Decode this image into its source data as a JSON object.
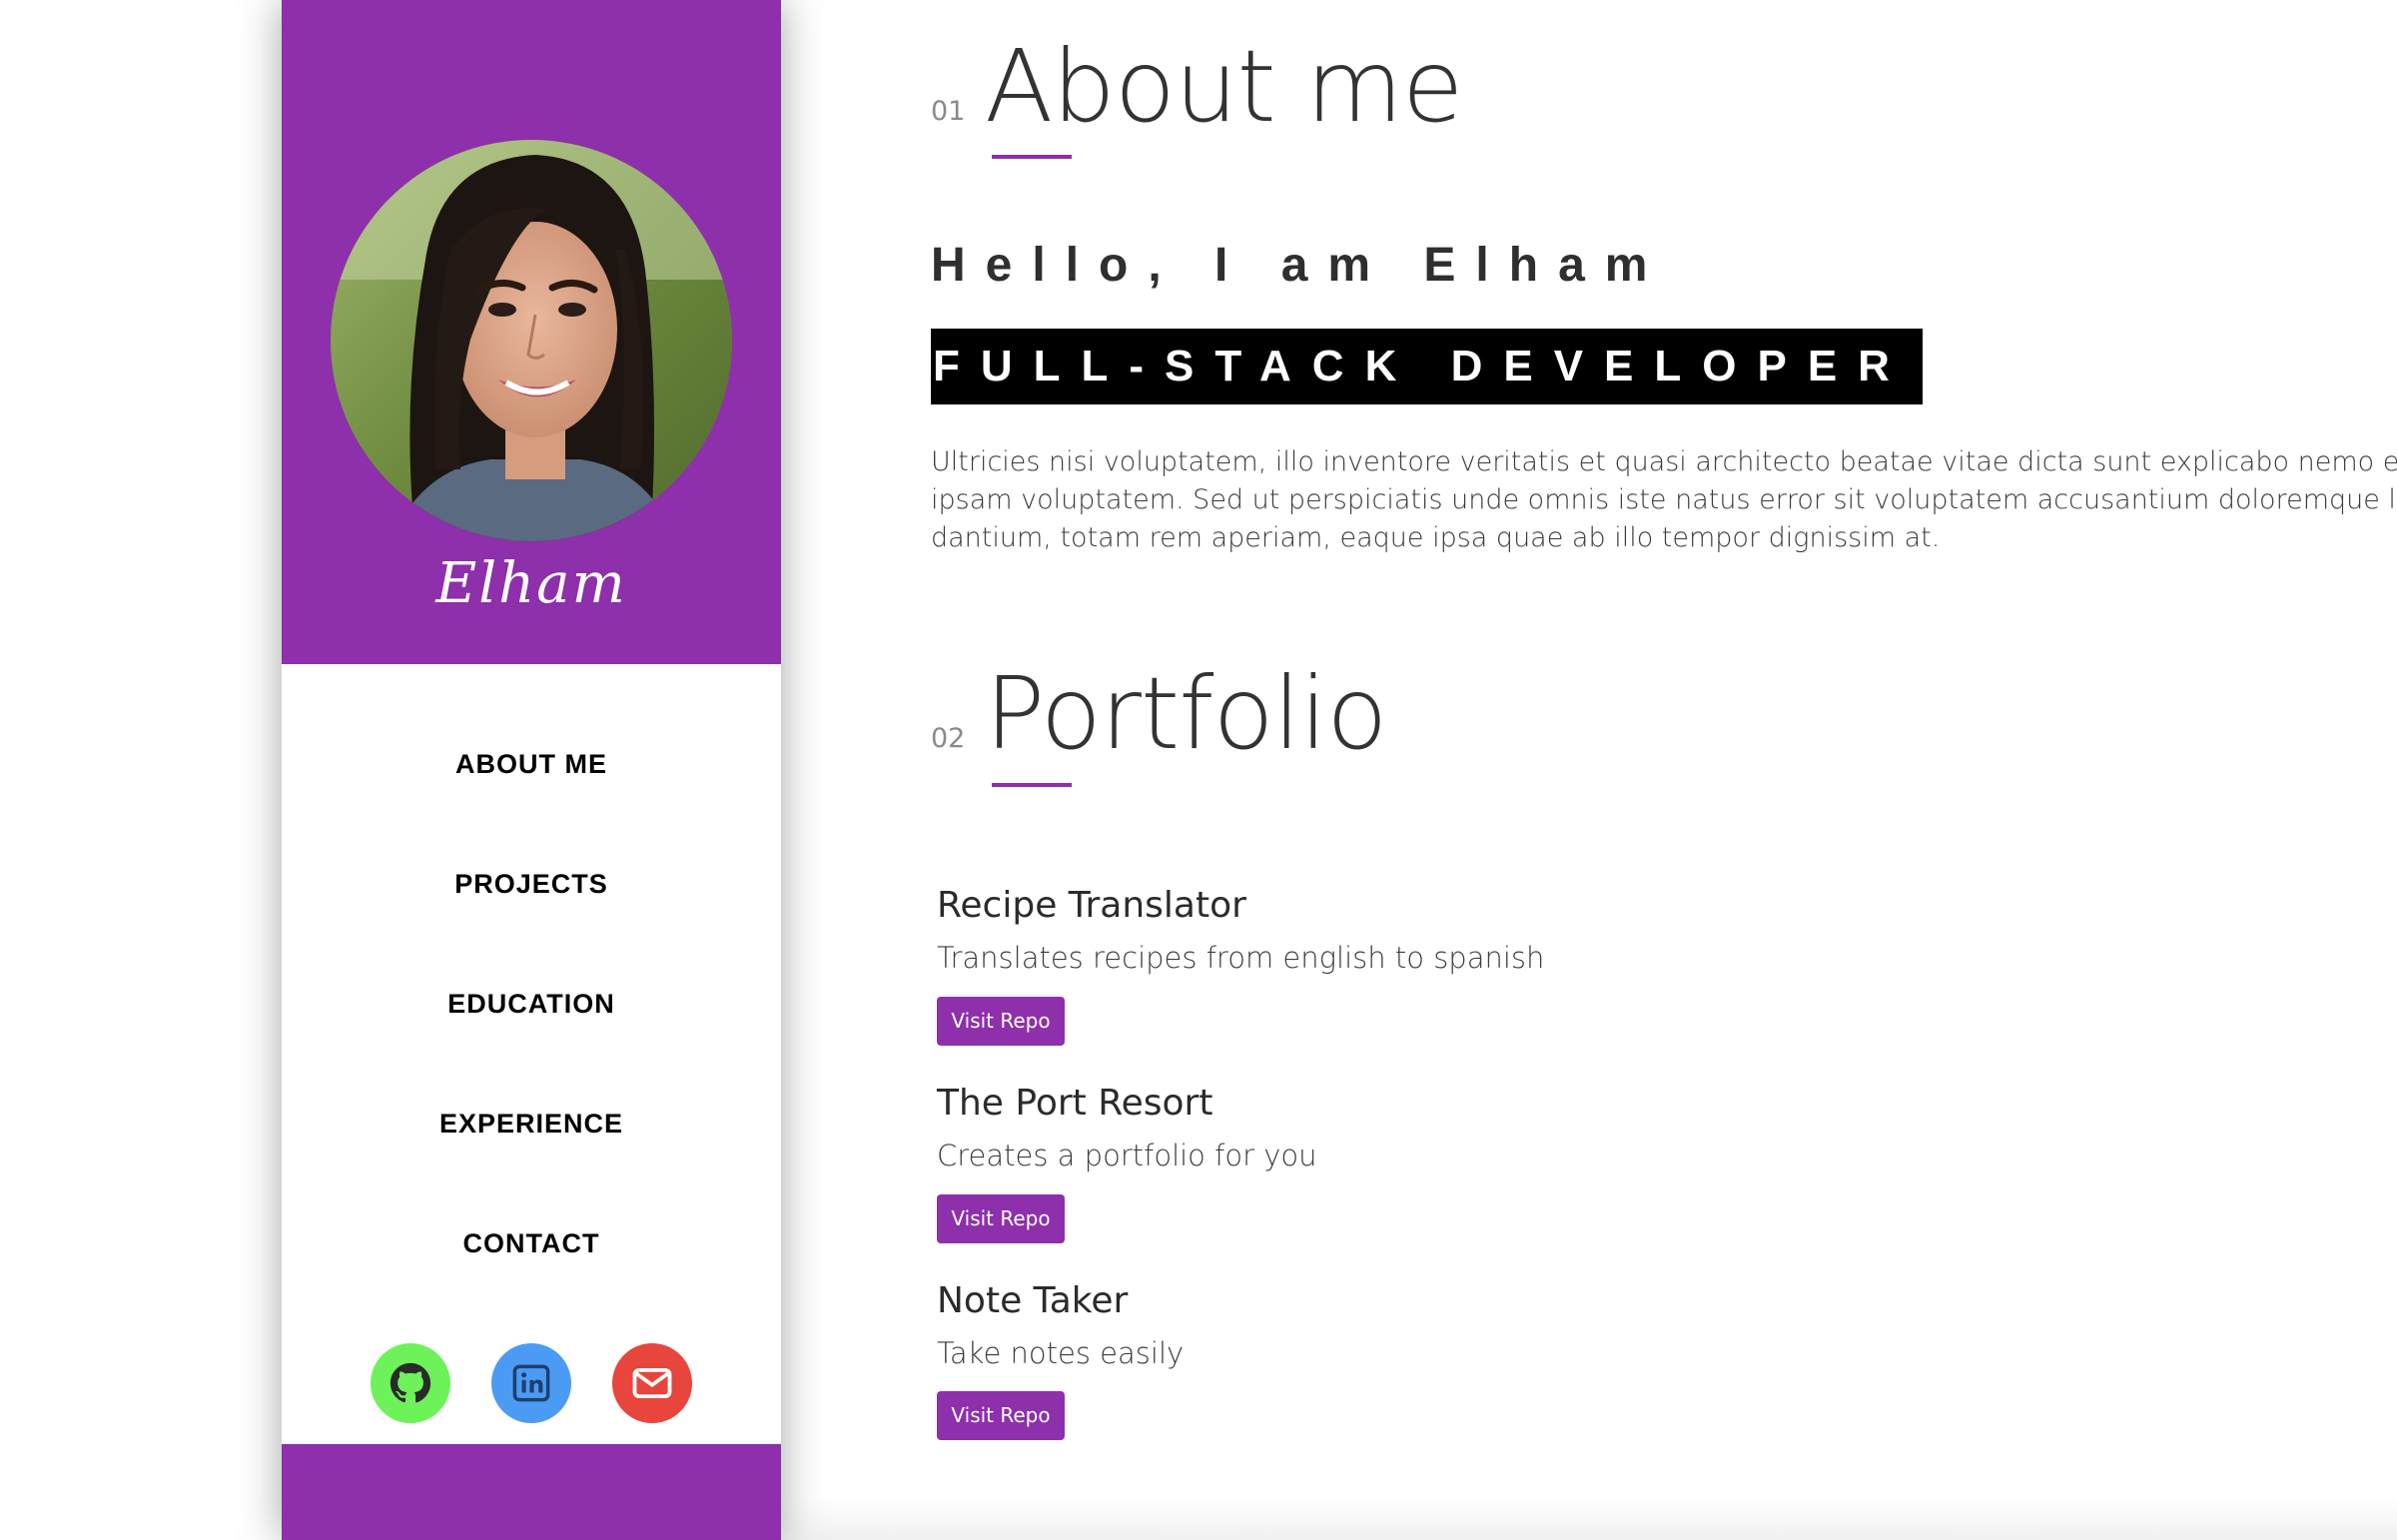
{
  "sidebar": {
    "brand": "Elham",
    "nav": [
      {
        "label": "ABOUT ME"
      },
      {
        "label": "PROJECTS"
      },
      {
        "label": "EDUCATION"
      },
      {
        "label": "EXPERIENCE"
      },
      {
        "label": "CONTACT"
      }
    ],
    "social": [
      {
        "icon": "github-icon",
        "color": "#6df25a"
      },
      {
        "icon": "linkedin-icon",
        "color": "#4b9bf5"
      },
      {
        "icon": "envelope-icon",
        "color": "#e8453c"
      }
    ]
  },
  "about": {
    "number": "01",
    "title": "About me",
    "greeting": "Hello, I am Elham",
    "role": "FULL-STACK DEVELOPER",
    "text_lines": [
      "Ultricies nisi voluptatem, illo inventore veritatis et quasi architecto beatae vitae dicta sunt explicabo nemo en",
      "ipsam voluptatem. Sed ut perspiciatis unde omnis iste natus error sit voluptatem accusantium doloremque l",
      "dantium, totam rem aperiam, eaque ipsa quae ab illo tempor dignissim at."
    ]
  },
  "portfolio": {
    "number": "02",
    "title": "Portfolio",
    "projects": [
      {
        "title": "Recipe Translator",
        "description": "Translates recipes from english to spanish",
        "button": "Visit Repo"
      },
      {
        "title": "The Port Resort",
        "description": "Creates a portfolio for you",
        "button": "Visit Repo"
      },
      {
        "title": "Note Taker",
        "description": "Take notes easily",
        "button": "Visit Repo"
      }
    ]
  },
  "colors": {
    "accent": "#8e2fab",
    "badge_bg": "#000000"
  }
}
